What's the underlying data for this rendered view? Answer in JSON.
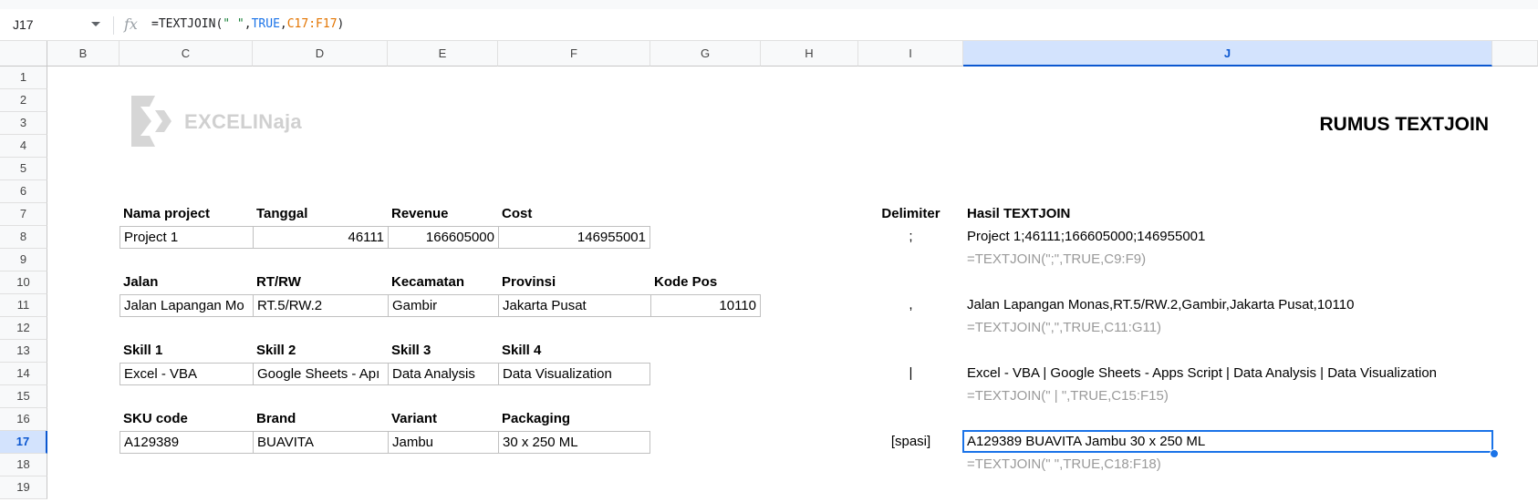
{
  "formula_bar": {
    "name_box": "J17",
    "fx_label": "fx",
    "formula_prefix": "=TEXTJOIN(",
    "formula_string": "\" \"",
    "formula_comma1": ",",
    "formula_bool": "TRUE",
    "formula_comma2": ",",
    "formula_range": "C17:F17",
    "formula_suffix": ")"
  },
  "columns": [
    "B",
    "C",
    "D",
    "E",
    "F",
    "G",
    "H",
    "I",
    "J"
  ],
  "rows": [
    "1",
    "2",
    "3",
    "4",
    "5",
    "6",
    "7",
    "8",
    "9",
    "10",
    "11",
    "12",
    "13",
    "14",
    "15",
    "16",
    "17",
    "18",
    "19"
  ],
  "logo": {
    "text": "EXCELINaja"
  },
  "title": "RUMUS TEXTJOIN",
  "tables": {
    "project": {
      "headers": [
        "Nama project",
        "Tanggal",
        "Revenue",
        "Cost"
      ],
      "values": [
        "Project 1",
        "46111",
        "166605000",
        "146955001"
      ]
    },
    "address": {
      "headers": [
        "Jalan",
        "RT/RW",
        "Kecamatan",
        "Provinsi",
        "Kode Pos"
      ],
      "values": [
        "Jalan Lapangan Mo",
        "RT.5/RW.2",
        "Gambir",
        "Jakarta Pusat",
        "10110"
      ]
    },
    "skills": {
      "headers": [
        "Skill 1",
        "Skill 2",
        "Skill 3",
        "Skill 4"
      ],
      "values": [
        "Excel - VBA",
        "Google Sheets - Apı",
        "Data Analysis",
        "Data Visualization"
      ]
    },
    "product": {
      "headers": [
        "SKU code",
        "Brand",
        "Variant",
        "Packaging"
      ],
      "values": [
        "A129389",
        "BUAVITA",
        "Jambu",
        "30 x 250 ML"
      ]
    }
  },
  "results": {
    "delimiter_header": "Delimiter",
    "result_header": "Hasil TEXTJOIN",
    "items": [
      {
        "delimiter": ";",
        "result": "Project 1;46111;166605000;146955001",
        "formula": "=TEXTJOIN(\";\",TRUE,C9:F9)"
      },
      {
        "delimiter": ",",
        "result": "Jalan Lapangan Monas,RT.5/RW.2,Gambir,Jakarta Pusat,10110",
        "formula": "=TEXTJOIN(\",\",TRUE,C11:G11)"
      },
      {
        "delimiter": "|",
        "result": "Excel - VBA | Google Sheets - Apps Script | Data Analysis | Data Visualization",
        "formula": "=TEXTJOIN(\" | \",TRUE,C15:F15)"
      },
      {
        "delimiter": "[spasi]",
        "result": "A129389 BUAVITA Jambu 30 x 250 ML",
        "formula": "=TEXTJOIN(\" \",TRUE,C18:F18)"
      }
    ]
  },
  "colors": {
    "selection": "#1a73e8",
    "formula_string": "#188038",
    "formula_bool": "#1a73e8",
    "formula_range": "#e37400",
    "formula_text_gray": "#9a9a9a"
  }
}
